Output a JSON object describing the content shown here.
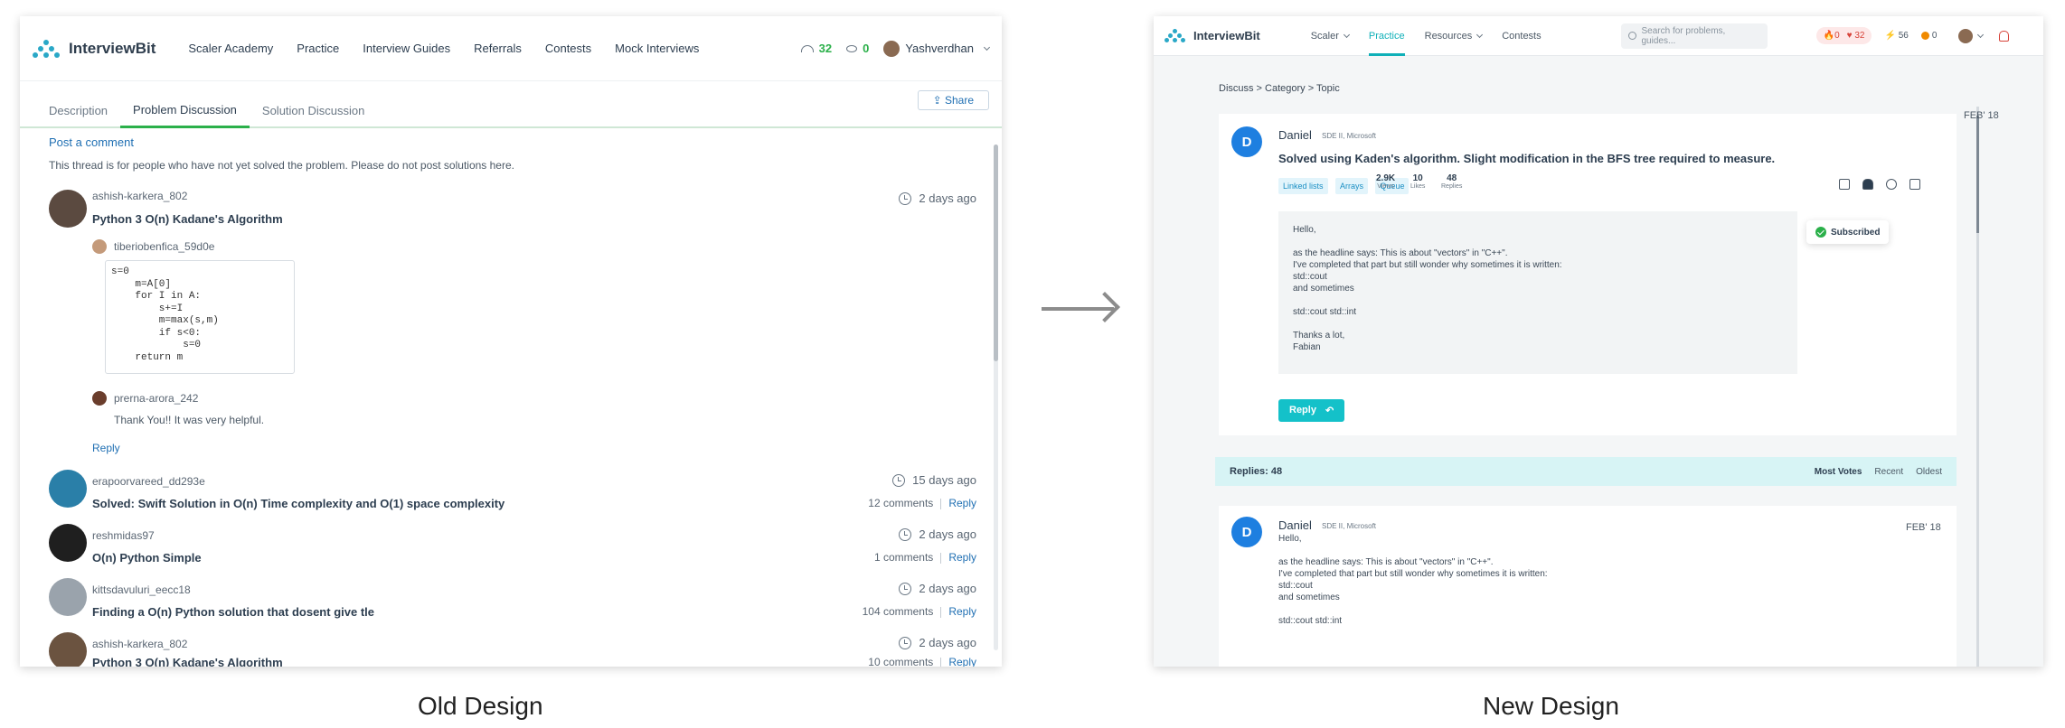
{
  "old": {
    "caption": "Old Design",
    "brand": "InterviewBit",
    "nav": [
      "Scaler Academy",
      "Practice",
      "Interview Guides",
      "Referrals",
      "Contests",
      "Mock Interviews"
    ],
    "stats": {
      "solved": "32",
      "coins": "0"
    },
    "user": "Yashverdhan",
    "tabs": [
      "Description",
      "Problem Discussion",
      "Solution Discussion"
    ],
    "share": "Share",
    "post_comment": "Post a comment",
    "notice": "This thread is for people who have not yet solved the problem. Please do not post solutions here.",
    "first": {
      "user": "ashish-karkera_802",
      "title": "Python 3 O(n) Kadane's Algorithm",
      "time": "2 days ago",
      "reply1_user": "tiberiobenfica_59d0e",
      "code": "s=0\n    m=A[0]\n    for I in A:\n        s+=I\n        m=max(s,m)\n        if s<0:\n            s=0\n    return m",
      "reply2_user": "prerna-arora_242",
      "reply2_text": "Thank You!! It was very helpful.",
      "reply": "Reply"
    },
    "threads": [
      {
        "user": "erapoorvareed_dd293e",
        "title": "Solved: Swift Solution in O(n) Time complexity and O(1) space complexity",
        "time": "15 days ago",
        "comments": "12 comments",
        "reply": "Reply"
      },
      {
        "user": "reshmidas97",
        "title": "O(n) Python Simple",
        "time": "2 days ago",
        "comments": "1 comments",
        "reply": "Reply"
      },
      {
        "user": "kittsdavuluri_eecc18",
        "title": "Finding a O(n) Python solution that dosent give tle",
        "time": "2 days ago",
        "comments": "104 comments",
        "reply": "Reply"
      },
      {
        "user": "ashish-karkera_802",
        "title": "Python 3 O(n) Kadane's Algorithm",
        "time": "2 days ago",
        "comments": "10 comments",
        "reply": "Reply"
      }
    ]
  },
  "new": {
    "caption": "New Design",
    "brand": "InterviewBit",
    "nav": [
      "Scaler",
      "Practice",
      "Resources",
      "Contests"
    ],
    "search_placeholder": "Search for problems, guides...",
    "pill": {
      "a": "0",
      "b": "32"
    },
    "stats": {
      "bolt": "56",
      "coin": "0"
    },
    "breadcrumb": "Discuss > Category > Topic",
    "post": {
      "initial": "D",
      "author": "Daniel",
      "role": "SDE II, Microsoft",
      "title": "Solved using Kaden's algorithm. Slight modification in the BFS tree required to measure.",
      "tags": [
        "Linked lists",
        "Arrays",
        "Queue"
      ],
      "views": "2.9K",
      "views_label": "Views",
      "likes": "10",
      "likes_label": "Likes",
      "replies": "48",
      "replies_label": "Replies",
      "date": "FEB' 18",
      "body": "Hello,\n\nas the headline says: This is about \"vectors\" in \"C++\".\nI've completed that part but still wonder why sometimes it is written:\nstd::cout\nand sometimes\n\nstd::cout std::int\n\nThanks a lot,\nFabian",
      "subscribed": "Subscribed",
      "reply": "Reply"
    },
    "replies_bar": {
      "label": "Replies: 48",
      "sort": [
        "Most Votes",
        "Recent",
        "Oldest"
      ]
    },
    "reply_card": {
      "initial": "D",
      "author": "Daniel",
      "role": "SDE II, Microsoft",
      "date": "FEB' 18",
      "body": "Hello,\n\nas the headline says: This is about \"vectors\" in \"C++\".\nI've completed that part but still wonder why sometimes it is written:\nstd::cout\nand sometimes\n\nstd::cout std::int"
    }
  }
}
